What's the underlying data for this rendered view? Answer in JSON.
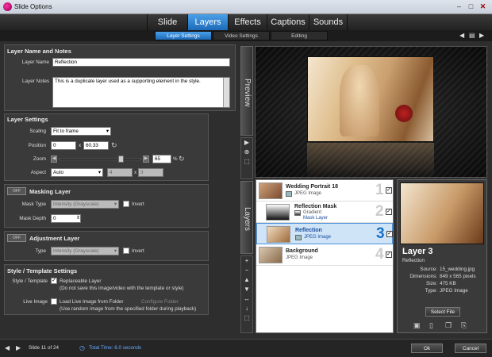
{
  "window": {
    "title": "Slide Options"
  },
  "main_tabs": [
    {
      "label": "Slide",
      "active": false
    },
    {
      "label": "Layers",
      "active": true
    },
    {
      "label": "Effects",
      "active": false
    },
    {
      "label": "Captions",
      "active": false
    },
    {
      "label": "Sounds",
      "active": false
    }
  ],
  "sub_tabs": [
    {
      "label": "Layer Settings",
      "active": true
    },
    {
      "label": "Video Settings",
      "active": false
    },
    {
      "label": "Editing",
      "active": false
    }
  ],
  "layer_name_notes": {
    "heading": "Layer Name and Notes",
    "name_label": "Layer Name",
    "name_value": "Reflection",
    "notes_label": "Layer Notes",
    "notes_value": "This is a duplicate layer used as a supporting element in the style."
  },
  "layer_settings": {
    "heading": "Layer Settings",
    "scaling_label": "Scaling",
    "scaling_value": "Fit to frame",
    "position_label": "Position",
    "position_x": "0",
    "position_sep": "x",
    "position_y": "60.33",
    "zoom_label": "Zoom",
    "zoom_value": "65",
    "zoom_unit": "%",
    "zoom_fraction": 0.78,
    "aspect_label": "Aspect",
    "aspect_value": "Auto",
    "aspect_w": "4",
    "aspect_sep": "x",
    "aspect_h": "3"
  },
  "masking_layer": {
    "toggle": "OFF",
    "heading": "Masking Layer",
    "mask_type_label": "Mask Type",
    "mask_type_value": "Intensity (Grayscale)",
    "invert_label": "Invert",
    "mask_depth_label": "Mask Depth",
    "mask_depth_value": "0"
  },
  "adjustment_layer": {
    "toggle": "OFF",
    "heading": "Adjustment Layer",
    "type_label": "Type",
    "type_value": "Intensity (Grayscale)",
    "invert_label": "Invert"
  },
  "style_template": {
    "heading": "Style / Template Settings",
    "st_label": "Style / Template",
    "replaceable_label": "Replaceable Layer",
    "replaceable_note": "(Do not save this image/video with the template or style)",
    "live_label": "Live Image",
    "load_live_label": "Load Live Image from Folder",
    "configure_label": "Configure Folder",
    "load_live_note": "(Use random image from the specified folder during playback)"
  },
  "preview": {
    "tab_label": "Preview"
  },
  "layers_panel": {
    "tab_label": "Layers",
    "items": [
      {
        "name": "Wedding Portrait 18",
        "type": "JPEG Image",
        "extra": "",
        "number": "1",
        "checked": "✓"
      },
      {
        "name": "Reflection Mask",
        "type": "Gradient",
        "extra": "Mask Layer",
        "number": "2",
        "checked": "✓"
      },
      {
        "name": "Reflection",
        "type": "JPEG Image",
        "extra": "",
        "number": "3",
        "checked": "✓"
      },
      {
        "name": "Background",
        "type": "JPEG Image",
        "extra": "",
        "number": "4",
        "checked": "✓"
      }
    ]
  },
  "layer_info": {
    "title": "Layer 3",
    "subtitle": "Reflection",
    "source_label": "Source:",
    "source_value": "15_wedding.jpg",
    "dimensions_label": "Dimensions:",
    "dimensions_value": "849 x 565 pixels",
    "size_label": "Size:",
    "size_value": "475 KB",
    "type_label": "Type:",
    "type_value": "JPEG Image",
    "select_file_label": "Select File"
  },
  "footer": {
    "slide_label": "Slide 11 of 24",
    "total_time_label": "Total Time: 6.0 seconds",
    "ok_label": "Ok",
    "cancel_label": "Cancel"
  },
  "colors": {
    "accent": "#2a7fd4",
    "panel_bg": "#3a3a3a",
    "window_bg": "#2e2e2e"
  }
}
